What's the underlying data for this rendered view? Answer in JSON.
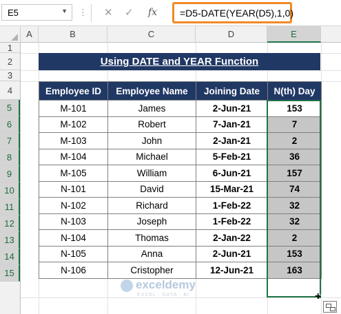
{
  "formula_bar": {
    "name_box": "E5",
    "cancel_icon": "✕",
    "enter_icon": "✓",
    "fx_label": "fx",
    "formula": "=D5-DATE(YEAR(D5),1,0)"
  },
  "columns": [
    "A",
    "B",
    "C",
    "D",
    "E"
  ],
  "rows": [
    "1",
    "2",
    "3",
    "4",
    "5",
    "6",
    "7",
    "8",
    "9",
    "10",
    "11",
    "12",
    "13",
    "14",
    "15"
  ],
  "active_cell": {
    "column": "E",
    "row": "5"
  },
  "title": "Using DATE and YEAR Function",
  "table": {
    "headers": [
      "Employee ID",
      "Employee Name",
      "Joining Date",
      "N(th) Day"
    ],
    "rows": [
      [
        "M-101",
        "James",
        "2-Jun-21",
        "153"
      ],
      [
        "M-102",
        "Robert",
        "7-Jan-21",
        "7"
      ],
      [
        "M-103",
        "John",
        "2-Jan-21",
        "2"
      ],
      [
        "M-104",
        "Michael",
        "5-Feb-21",
        "36"
      ],
      [
        "M-105",
        "William",
        "6-Jun-21",
        "157"
      ],
      [
        "N-101",
        "David",
        "15-Mar-21",
        "74"
      ],
      [
        "N-102",
        "Richard",
        "1-Feb-22",
        "32"
      ],
      [
        "N-103",
        "Joseph",
        "1-Feb-22",
        "32"
      ],
      [
        "N-104",
        "Thomas",
        "2-Jan-22",
        "2"
      ],
      [
        "N-105",
        "Anna",
        "2-Jun-21",
        "153"
      ],
      [
        "N-106",
        "Cristopher",
        "12-Jun-21",
        "163"
      ]
    ]
  },
  "watermark": {
    "name": "exceldemy",
    "tagline": "EXCEL · DATA · BI"
  },
  "colors": {
    "header_bg": "#203864",
    "selection": "#217346",
    "formula_highlight": "#f08a24"
  },
  "icons": {
    "cancel": "close-icon",
    "enter": "check-icon",
    "function": "fx-icon",
    "dropdown": "chevron-down-icon"
  }
}
